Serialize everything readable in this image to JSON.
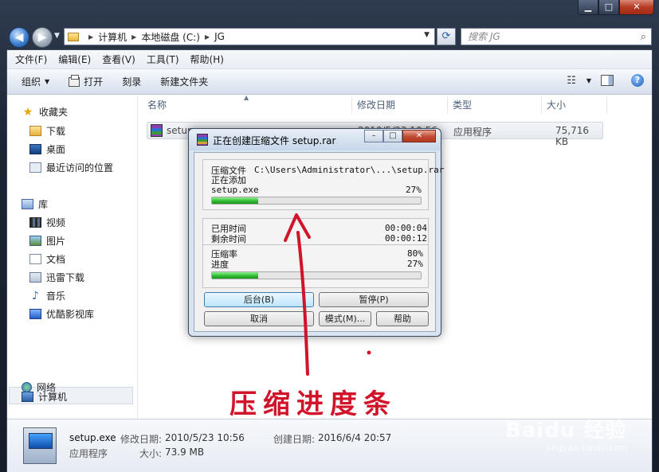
{
  "window": {
    "buttons": {
      "minimize": "▁",
      "maximize": "□",
      "close": "✕"
    }
  },
  "nav": {
    "back": "◀",
    "forward": "▶",
    "address": [
      "计算机",
      "本地磁盘 (C:)",
      "JG"
    ],
    "search_placeholder": "搜索 JG"
  },
  "menu": [
    "文件(F)",
    "编辑(E)",
    "查看(V)",
    "工具(T)",
    "帮助(H)"
  ],
  "toolbar": {
    "organize": "组织",
    "open": "打开",
    "burn": "刻录",
    "new_folder": "新建文件夹"
  },
  "sidebar": {
    "favorites": {
      "label": "收藏夹",
      "items": [
        "下载",
        "桌面",
        "最近访问的位置"
      ]
    },
    "libraries": {
      "label": "库",
      "items": [
        "视频",
        "图片",
        "文档",
        "迅雷下载",
        "音乐",
        "优酷影视库"
      ]
    },
    "computer": "计算机",
    "network": "网络"
  },
  "columns": {
    "name": "名称",
    "modified": "修改日期",
    "type": "类型",
    "size": "大小"
  },
  "file": {
    "name": "setup",
    "modified": "2010/5/23 10:56",
    "type": "应用程序",
    "size": "75,716 KB"
  },
  "details": {
    "filename": "setup.exe",
    "modified_label": "修改日期:",
    "modified_value": "2010/5/23 10:56",
    "created_label": "创建日期:",
    "created_value": "2016/6/4 20:57",
    "type": "应用程序",
    "size_label": "大小:",
    "size_value": "73.9 MB"
  },
  "dialog": {
    "title": "正在创建压缩文件 setup.rar",
    "buttons_caption": {
      "min": "–",
      "max": "□",
      "close": "✕"
    },
    "compressing_label": "压缩文件",
    "compressing_path": "C:\\Users\\Administrator\\...\\setup.rar",
    "adding_label": "正在添加",
    "current_file": "setup.exe",
    "file_percent_text": "27%",
    "file_progress": 0.22,
    "elapsed_label": "已用时间",
    "elapsed_value": "00:00:04",
    "remaining_label": "剩余时间",
    "remaining_value": "00:00:12",
    "ratio_label": "压缩率",
    "ratio_value": "80%",
    "progress_label": "进度",
    "progress_value": "27%",
    "total_progress": 0.22,
    "btn_background": "后台(B)",
    "btn_pause": "暂停(P)",
    "btn_cancel": "取消",
    "btn_mode": "模式(M)...",
    "btn_help": "帮助"
  },
  "annotation": {
    "text": "压缩进度条",
    "color": "#d2142a"
  },
  "watermark": {
    "brand": "Baidu 经验",
    "sub": "jingyan.baidu.com"
  }
}
